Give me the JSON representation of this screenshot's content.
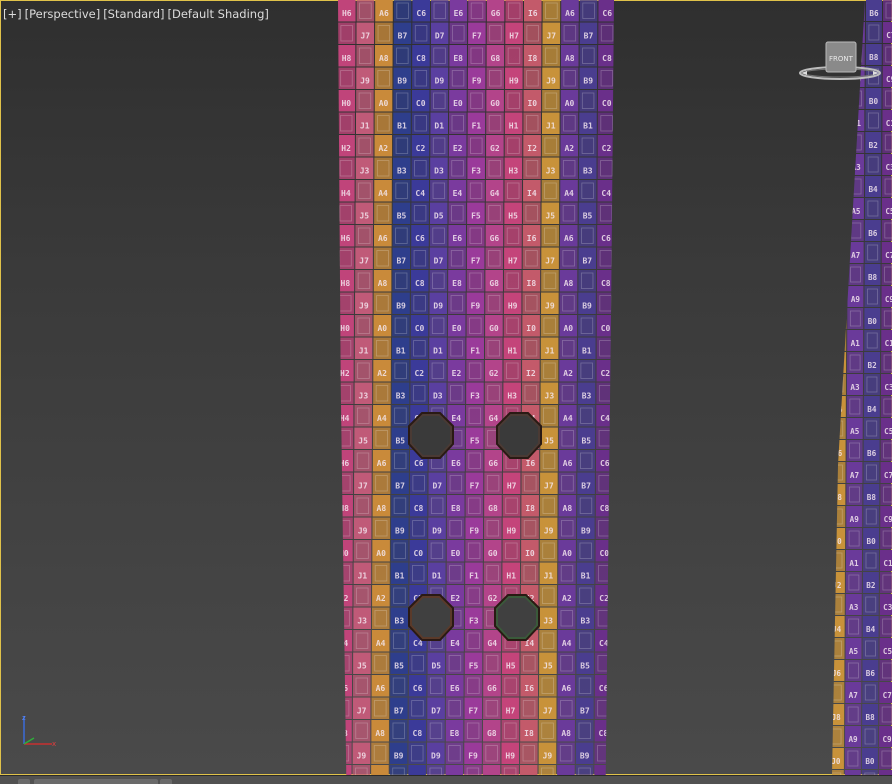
{
  "viewport": {
    "labels": [
      {
        "id": "plus",
        "text": "[+]"
      },
      {
        "id": "view",
        "text": "[Perspective]"
      },
      {
        "id": "mode",
        "text": "[Standard]"
      },
      {
        "id": "shading",
        "text": "[Default Shading]"
      }
    ],
    "border_color": "#e0c24a",
    "background_color": "#3a3a3a"
  },
  "viewcube": {
    "face_label": "FRONT"
  },
  "texture": {
    "columns": [
      "H",
      "J",
      "A",
      "B",
      "C",
      "D",
      "E",
      "F",
      "G",
      "H",
      "I",
      "J",
      "A",
      "B",
      "C"
    ],
    "stripe_colors": [
      "#c0447a",
      "#c05a78",
      "#c98a3a",
      "#2e3e8c",
      "#3b3a99",
      "#5a3fa0",
      "#7a3a9e",
      "#9a3a9a",
      "#b3448a",
      "#c4447a",
      "#c35a6a",
      "#c8923a",
      "#6a3a9a",
      "#4a3d8f",
      "#6a2f8a"
    ],
    "row_start": 6
  },
  "statusbar": {
    "items": [
      "",
      ""
    ]
  }
}
